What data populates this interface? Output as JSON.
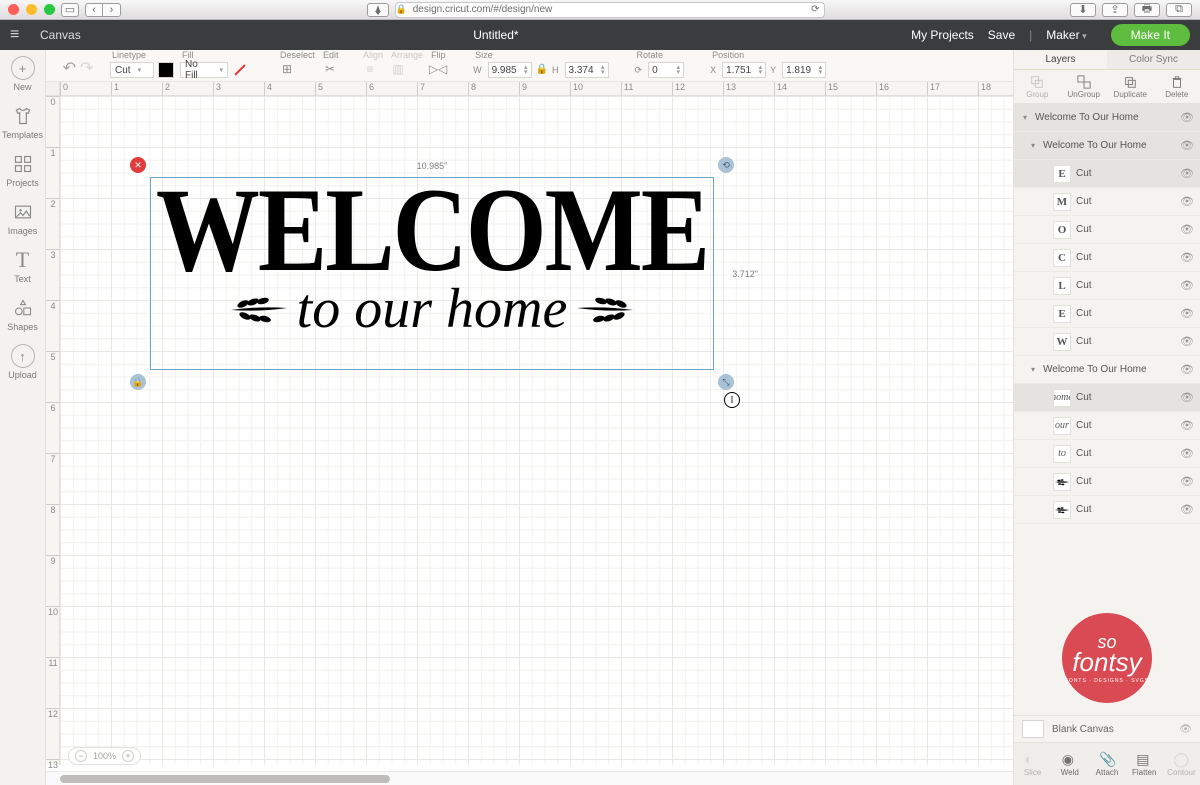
{
  "browser": {
    "url": "design.cricut.com/#/design/new"
  },
  "app": {
    "screen": "Canvas",
    "title": "Untitled*",
    "my_projects": "My Projects",
    "save": "Save",
    "machine": "Maker",
    "make_it": "Make It"
  },
  "left_toolbar": [
    {
      "key": "new",
      "label": "New"
    },
    {
      "key": "templates",
      "label": "Templates"
    },
    {
      "key": "projects",
      "label": "Projects"
    },
    {
      "key": "images",
      "label": "Images"
    },
    {
      "key": "text",
      "label": "Text"
    },
    {
      "key": "shapes",
      "label": "Shapes"
    },
    {
      "key": "upload",
      "label": "Upload"
    }
  ],
  "context": {
    "linetype_label": "Linetype",
    "linetype": "Cut",
    "fill_label": "Fill",
    "fill": "No Fill",
    "deselect": "Deselect",
    "edit": "Edit",
    "align": "Align",
    "arrange": "Arrange",
    "flip": "Flip",
    "size": "Size",
    "w": "9.985",
    "h": "3.374",
    "rotate": "Rotate",
    "rot": "0",
    "position": "Position",
    "x": "1.751",
    "y": "1.819"
  },
  "selection": {
    "w": "10.985\"",
    "h": "3.712\""
  },
  "artwork": {
    "line1": "WELCOME",
    "line2": "to our home"
  },
  "zoom": "100%",
  "right": {
    "tab_layers": "Layers",
    "tab_sync": "Color Sync",
    "actions": {
      "group": "Group",
      "ungroup": "UnGroup",
      "duplicate": "Duplicate",
      "delete": "Delete"
    },
    "layers": [
      {
        "indent": 0,
        "chev": "▾",
        "name": "Welcome To Our Home",
        "sel": true,
        "thumb": ""
      },
      {
        "indent": 1,
        "chev": "▾",
        "name": "Welcome To Our Home",
        "sel": true,
        "thumb": ""
      },
      {
        "indent": 2,
        "name": "Cut",
        "sel": true,
        "thumb": "E"
      },
      {
        "indent": 2,
        "name": "Cut",
        "sel": false,
        "thumb": "M"
      },
      {
        "indent": 2,
        "name": "Cut",
        "sel": false,
        "thumb": "O"
      },
      {
        "indent": 2,
        "name": "Cut",
        "sel": false,
        "thumb": "C"
      },
      {
        "indent": 2,
        "name": "Cut",
        "sel": false,
        "thumb": "L"
      },
      {
        "indent": 2,
        "name": "Cut",
        "sel": false,
        "thumb": "E"
      },
      {
        "indent": 2,
        "name": "Cut",
        "sel": false,
        "thumb": "W"
      },
      {
        "indent": 1,
        "chev": "▾",
        "name": "Welcome To Our Home",
        "sel": false,
        "thumb": ""
      },
      {
        "indent": 2,
        "name": "Cut",
        "sel": true,
        "thumb": "home",
        "script": true
      },
      {
        "indent": 2,
        "name": "Cut",
        "sel": false,
        "thumb": "our",
        "script": true
      },
      {
        "indent": 2,
        "name": "Cut",
        "sel": false,
        "thumb": "to",
        "script": true
      },
      {
        "indent": 2,
        "name": "Cut",
        "sel": false,
        "thumb": "leaf"
      },
      {
        "indent": 2,
        "name": "Cut",
        "sel": false,
        "thumb": "leaf"
      }
    ],
    "blank_canvas": "Blank Canvas",
    "bottom": {
      "slice": "Slice",
      "weld": "Weld",
      "attach": "Attach",
      "flatten": "Flatten",
      "contour": "Contour"
    }
  },
  "watermark": {
    "l1": "so",
    "l2": "fontsy",
    "l3": "FONTS · DESIGNS · SVGS"
  }
}
